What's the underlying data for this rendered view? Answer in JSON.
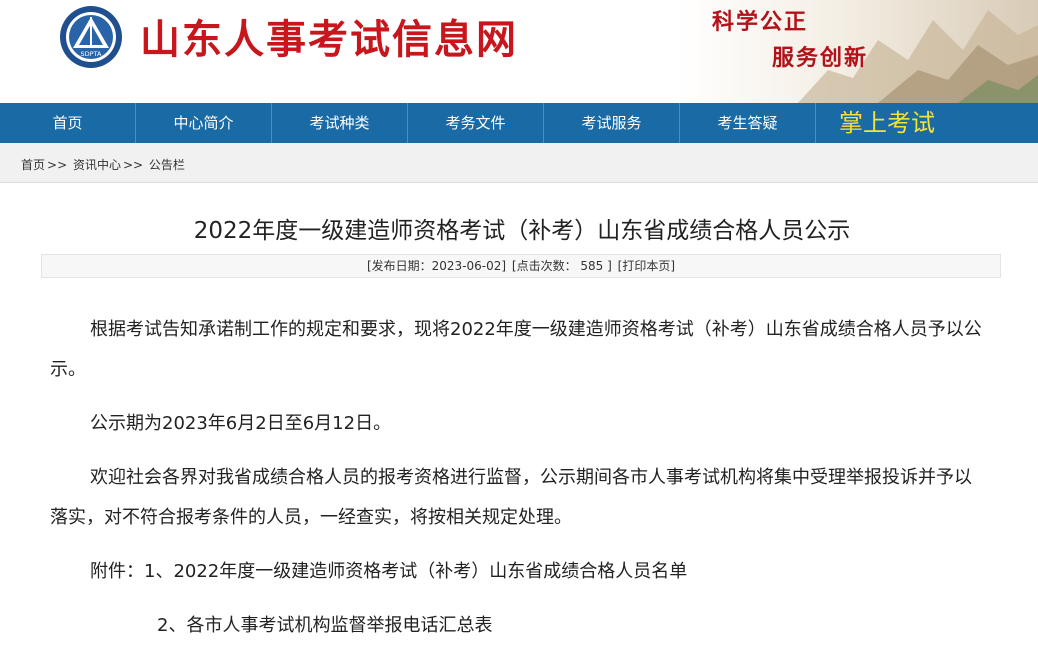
{
  "header": {
    "logo_text": "SDPTA",
    "site_title": "山东人事考试信息网",
    "slogan_line1": "科学公正",
    "slogan_line2": "服务创新"
  },
  "nav": {
    "items": [
      {
        "label": "首页"
      },
      {
        "label": "中心简介"
      },
      {
        "label": "考试种类"
      },
      {
        "label": "考务文件"
      },
      {
        "label": "考试服务"
      },
      {
        "label": "考生答疑"
      }
    ],
    "special": "掌上考试"
  },
  "breadcrumb": {
    "items": [
      "首页",
      "资讯中心",
      "公告栏"
    ],
    "separator": ">>"
  },
  "article": {
    "title": "2022年度一级建造师资格考试（补考）山东省成绩合格人员公示",
    "meta": {
      "date_label": "[发布日期：2023-06-02]",
      "clicks_label": "[点击次数：  585 ]",
      "print_label": "[打印本页]"
    },
    "paragraphs": [
      "根据考试告知承诺制工作的规定和要求，现将2022年度一级建造师资格考试（补考）山东省成绩合格人员予以公示。",
      "公示期为2023年6月2日至6月12日。",
      "欢迎社会各界对我省成绩合格人员的报考资格进行监督，公示期间各市人事考试机构将集中受理举报投诉并予以落实，对不符合报考条件的人员，一经查实，将按相关规定处理。",
      "附件：1、2022年度一级建造师资格考试（补考）山东省成绩合格人员名单",
      "2、各市人事考试机构监督举报电话汇总表"
    ]
  },
  "colors": {
    "brand_red": "#c8161d",
    "nav_blue": "#1a6aa6",
    "nav_special": "#f4e13a"
  }
}
